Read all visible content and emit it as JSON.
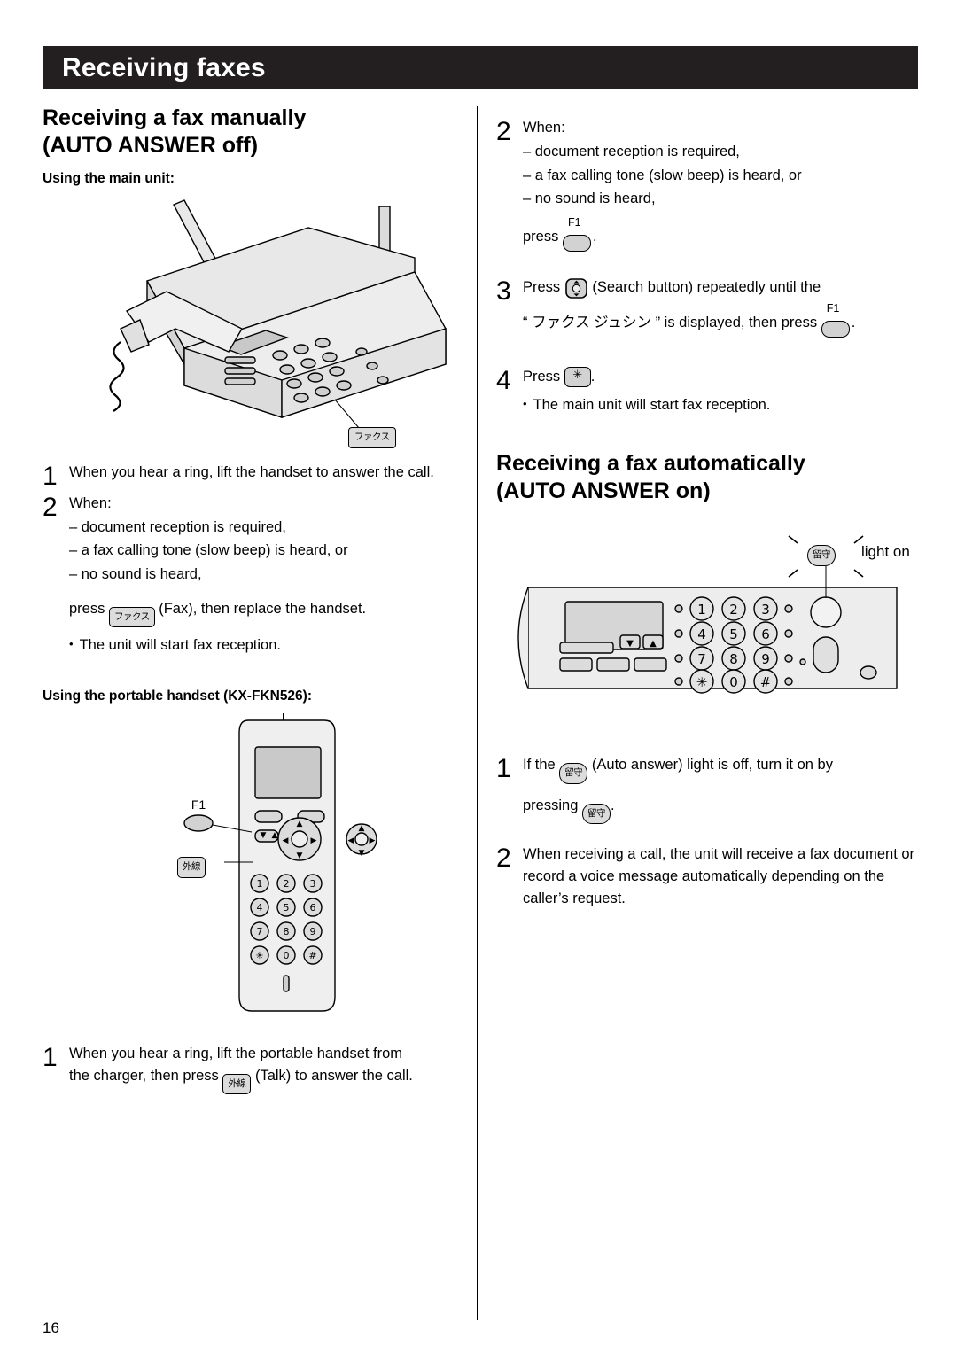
{
  "header": {
    "title": "Receiving faxes"
  },
  "page_number": "16",
  "left_column": {
    "section_title": "Receiving a fax manually (AUTO ANSWER off)",
    "section_title_line1": "Receiving a fax manually",
    "section_title_line2": "(AUTO ANSWER off)",
    "subhead_main_unit": "Using the main unit:",
    "fax_button_label": "ファクス",
    "step1": {
      "num": "1",
      "text": "When you hear a ring, lift the handset to answer the call."
    },
    "step2": {
      "num": "2",
      "text": "When:",
      "bullets": [
        "– document reception is required,",
        "– a fax calling tone (slow beep) is heard, or",
        "– no sound is heard,"
      ],
      "press_prefix": "press",
      "key_label": "ファクス",
      "press_suffix": "(Fax), then replace the handset.",
      "note": "The unit will start fax reception."
    },
    "subhead_portable": "Using the portable handset (KX-FKN526):",
    "handset": {
      "f1_label": "F1",
      "talk_label": "外線",
      "keys": [
        "1",
        "2",
        "3",
        "4",
        "5",
        "6",
        "7",
        "8",
        "9",
        "✳",
        "0",
        "#"
      ]
    },
    "step_portable": {
      "num": "1",
      "text_line1": "When you hear a ring, lift the portable handset from",
      "text_line2_prefix": "the charger, then press",
      "key_label": "外線",
      "text_line2_suffix": "(Talk) to answer the call."
    }
  },
  "right_column": {
    "step2": {
      "num": "2",
      "text": "When:",
      "bullets": [
        "– document reception is required,",
        "– a fax calling tone (slow beep) is heard, or",
        "– no sound is heard,"
      ],
      "press_prefix": "press",
      "f1_label": "F1",
      "press_suffix": "."
    },
    "step3": {
      "num": "3",
      "prefix": "Press",
      "middle": "(Search button) repeatedly until the",
      "line2_prefix": "“ ファクス ジュシン ” is displayed, then press",
      "f1_label": "F1",
      "line2_suffix": "."
    },
    "step4": {
      "num": "4",
      "prefix": "Press",
      "suffix": ".",
      "note": "The main unit will start fax reception."
    },
    "section_title_line1": "Receiving a fax automatically",
    "section_title_line2": "(AUTO ANSWER on)",
    "light_on_label": "light on",
    "auto_answer_key_label": "留守",
    "unit_keys": [
      "1",
      "2",
      "3",
      "4",
      "5",
      "6",
      "7",
      "8",
      "9",
      "✳",
      "0",
      "#"
    ],
    "step1": {
      "num": "1",
      "prefix": "If the",
      "key_label": "留守",
      "middle": "(Auto answer) light is off, turn it on by",
      "line2_prefix": "pressing",
      "line2_suffix": "."
    },
    "step2b": {
      "num": "2",
      "text": "When receiving a call, the unit will receive a fax document or record a voice message automatically depending on the caller’s request."
    }
  },
  "colors": {
    "header_bg": "#231f20",
    "key_face": "#d2d2d2",
    "device_body": "#e8e8e8",
    "device_dark": "#b9b9b9"
  }
}
